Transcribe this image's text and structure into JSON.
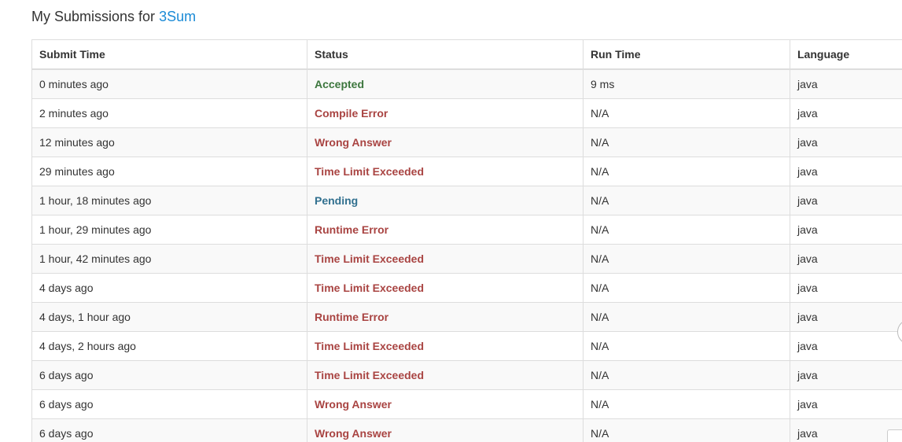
{
  "header": {
    "prefix": "My Submissions for",
    "problem": "3Sum"
  },
  "table": {
    "columns": [
      "Submit Time",
      "Status",
      "Run Time",
      "Language"
    ],
    "rows": [
      {
        "time": "0 minutes ago",
        "status": "Accepted",
        "kind": "ok",
        "runtime": "9 ms",
        "language": "java"
      },
      {
        "time": "2 minutes ago",
        "status": "Compile Error",
        "kind": "err",
        "runtime": "N/A",
        "language": "java"
      },
      {
        "time": "12 minutes ago",
        "status": "Wrong Answer",
        "kind": "err",
        "runtime": "N/A",
        "language": "java"
      },
      {
        "time": "29 minutes ago",
        "status": "Time Limit Exceeded",
        "kind": "err",
        "runtime": "N/A",
        "language": "java"
      },
      {
        "time": "1 hour, 18 minutes ago",
        "status": "Pending",
        "kind": "pend",
        "runtime": "N/A",
        "language": "java"
      },
      {
        "time": "1 hour, 29 minutes ago",
        "status": "Runtime Error",
        "kind": "err",
        "runtime": "N/A",
        "language": "java"
      },
      {
        "time": "1 hour, 42 minutes ago",
        "status": "Time Limit Exceeded",
        "kind": "err",
        "runtime": "N/A",
        "language": "java"
      },
      {
        "time": "4 days ago",
        "status": "Time Limit Exceeded",
        "kind": "err",
        "runtime": "N/A",
        "language": "java"
      },
      {
        "time": "4 days, 1 hour ago",
        "status": "Runtime Error",
        "kind": "err",
        "runtime": "N/A",
        "language": "java"
      },
      {
        "time": "4 days, 2 hours ago",
        "status": "Time Limit Exceeded",
        "kind": "err",
        "runtime": "N/A",
        "language": "java"
      },
      {
        "time": "6 days ago",
        "status": "Time Limit Exceeded",
        "kind": "err",
        "runtime": "N/A",
        "language": "java"
      },
      {
        "time": "6 days ago",
        "status": "Wrong Answer",
        "kind": "err",
        "runtime": "N/A",
        "language": "java"
      },
      {
        "time": "6 days ago",
        "status": "Wrong Answer",
        "kind": "err",
        "runtime": "N/A",
        "language": "java"
      }
    ]
  },
  "colors": {
    "link": "#1a8ad6",
    "accepted": "#3c763d",
    "error": "#a94442",
    "pending": "#31708f"
  }
}
